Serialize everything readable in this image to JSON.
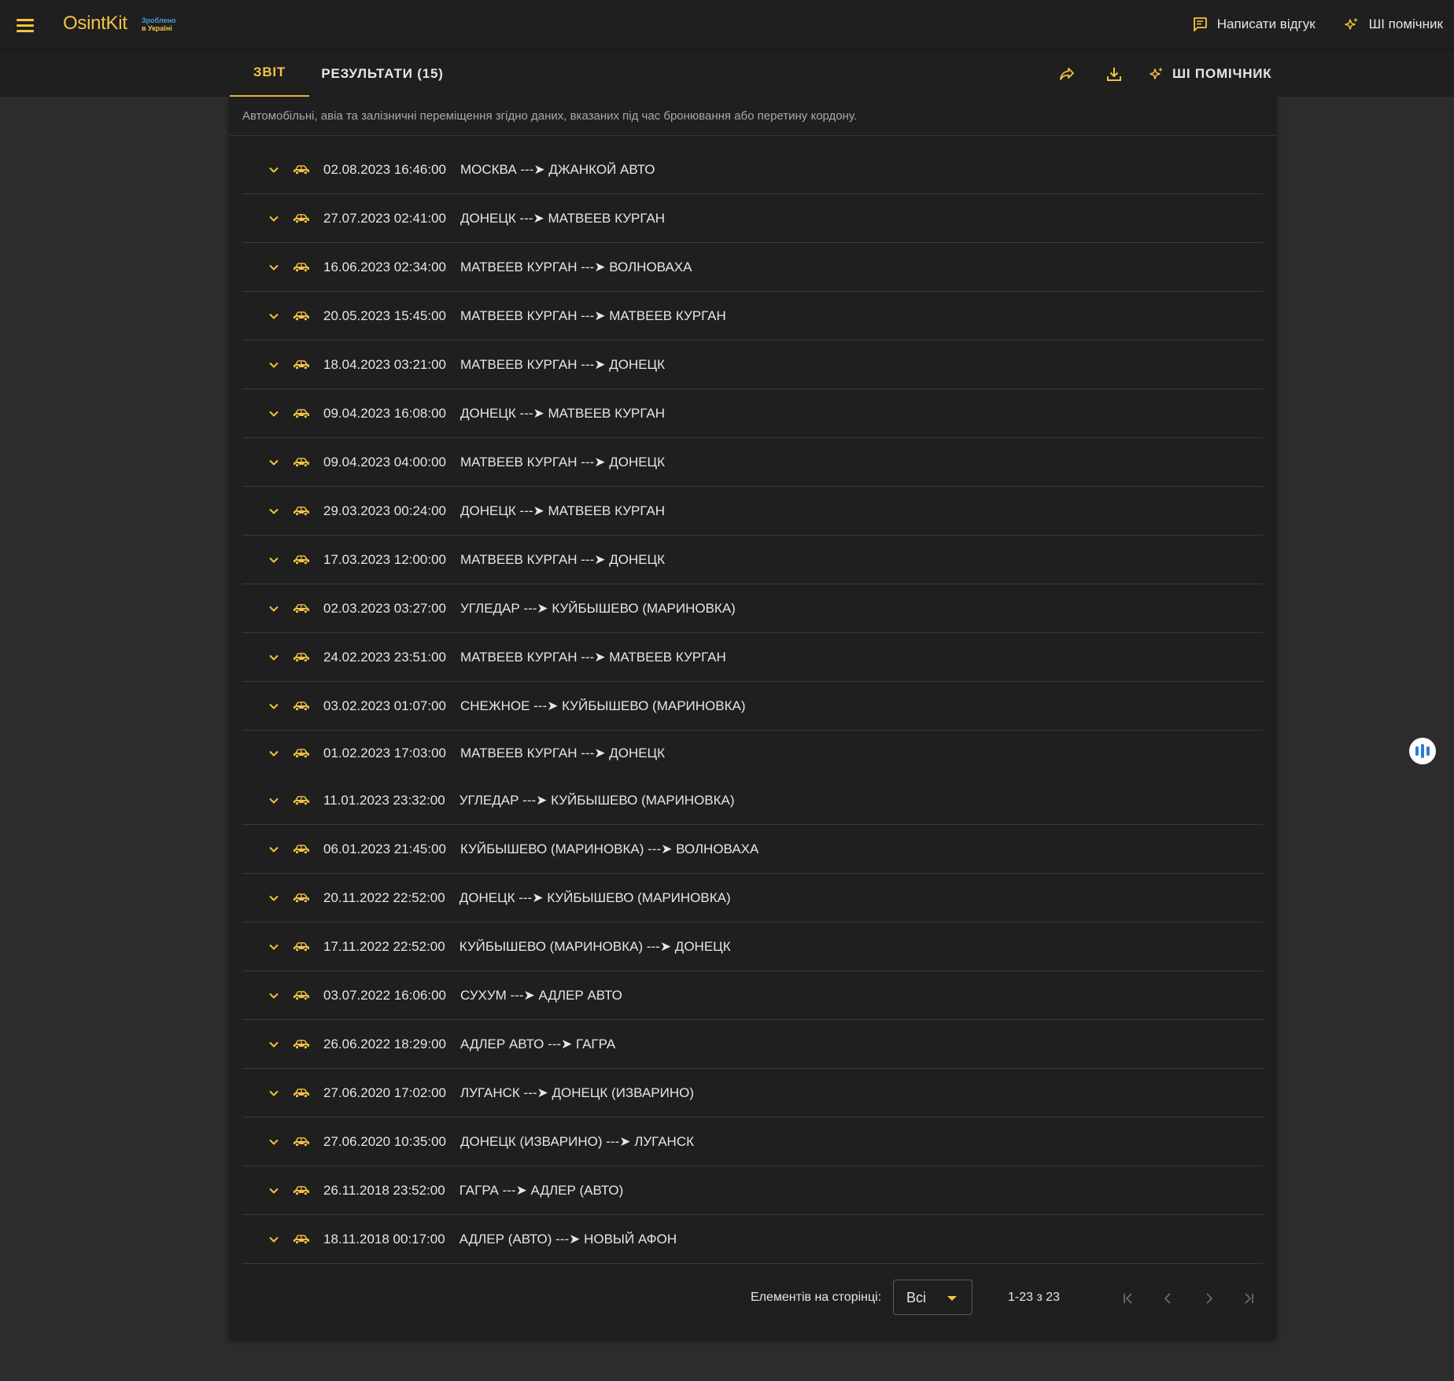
{
  "app": {
    "logo": "OsintKit",
    "badge_line1": "Зроблено",
    "badge_line2": "в Україні",
    "feedback_label": "Написати відгук",
    "ai_helper_label": "ШІ помічник"
  },
  "tabs": {
    "report": "ЗВІТ",
    "results": "РЕЗУЛЬТАТИ (15)",
    "ai_helper": "ШІ ПОМІЧНИК"
  },
  "description": "Автомобільні, авіа та залізничні переміщення згідно даних, вказаних під час бронювання або перетину кордону.",
  "trips": [
    {
      "time": "02.08.2023 16:46:00",
      "route": "МОСКВА ---➤ ДЖАНКОЙ АВТО",
      "icon": "car-icon"
    },
    {
      "time": "27.07.2023 02:41:00",
      "route": "ДОНЕЦК ---➤ МАТВЕЕВ КУРГАН",
      "icon": "car-icon"
    },
    {
      "time": "16.06.2023 02:34:00",
      "route": "МАТВЕЕВ КУРГАН ---➤ ВОЛНОВАХА",
      "icon": "car-icon"
    },
    {
      "time": "20.05.2023 15:45:00",
      "route": "МАТВЕЕВ КУРГАН ---➤ МАТВЕЕВ КУРГАН",
      "icon": "car-icon"
    },
    {
      "time": "18.04.2023 03:21:00",
      "route": "МАТВЕЕВ КУРГАН ---➤ ДОНЕЦК",
      "icon": "car-icon"
    },
    {
      "time": "09.04.2023 16:08:00",
      "route": "ДОНЕЦК ---➤ МАТВЕЕВ КУРГАН",
      "icon": "car-icon"
    },
    {
      "time": "09.04.2023 04:00:00",
      "route": "МАТВЕЕВ КУРГАН ---➤ ДОНЕЦК",
      "icon": "car-icon"
    },
    {
      "time": "29.03.2023 00:24:00",
      "route": "ДОНЕЦК ---➤ МАТВЕЕВ КУРГАН",
      "icon": "car-icon"
    },
    {
      "time": "17.03.2023 12:00:00",
      "route": "МАТВЕЕВ КУРГАН ---➤ ДОНЕЦК",
      "icon": "car-icon"
    },
    {
      "time": "02.03.2023 03:27:00",
      "route": "УГЛЕДАР ---➤ КУЙБЫШЕВО (МАРИНОВКА)",
      "icon": "car-icon"
    },
    {
      "time": "24.02.2023 23:51:00",
      "route": "МАТВЕЕВ КУРГАН ---➤ МАТВЕЕВ КУРГАН",
      "icon": "car-icon"
    },
    {
      "time": "03.02.2023 01:07:00",
      "route": "СНЕЖНОЕ ---➤ КУЙБЫШЕВО (МАРИНОВКА)",
      "icon": "car-icon"
    },
    {
      "time": "01.02.2023 17:03:00",
      "route": "МАТВЕЕВ КУРГАН ---➤ ДОНЕЦК",
      "icon": "car-icon"
    },
    {
      "time": "11.01.2023 23:32:00",
      "route": "УГЛЕДАР ---➤ КУЙБЫШЕВО (МАРИНОВКА)",
      "icon": "car-icon"
    },
    {
      "time": "06.01.2023 21:45:00",
      "route": "КУЙБЫШЕВО (МАРИНОВКА) ---➤ ВОЛНОВАХА",
      "icon": "car-icon"
    },
    {
      "time": "20.11.2022 22:52:00",
      "route": "ДОНЕЦК ---➤ КУЙБЫШЕВО (МАРИНОВКА)",
      "icon": "car-icon"
    },
    {
      "time": "17.11.2022 22:52:00",
      "route": "КУЙБЫШЕВО (МАРИНОВКА) ---➤ ДОНЕЦК",
      "icon": "car-icon"
    },
    {
      "time": "03.07.2022 16:06:00",
      "route": "СУХУМ ---➤ АДЛЕР АВТО",
      "icon": "car-icon"
    },
    {
      "time": "26.06.2022 18:29:00",
      "route": "АДЛЕР АВТО ---➤ ГАГРА",
      "icon": "car-icon"
    },
    {
      "time": "27.06.2020 17:02:00",
      "route": "ЛУГАНСК ---➤ ДОНЕЦК (ИЗВАРИНО)",
      "icon": "car-icon"
    },
    {
      "time": "27.06.2020 10:35:00",
      "route": "ДОНЕЦК (ИЗВАРИНО) ---➤ ЛУГАНСК",
      "icon": "car-icon"
    },
    {
      "time": "26.11.2018 23:52:00",
      "route": "ГАГРА ---➤ АДЛЕР (АВТО)",
      "icon": "car-icon"
    },
    {
      "time": "18.11.2018 00:17:00",
      "route": "АДЛЕР (АВТО) ---➤ НОВЫЙ АФОН",
      "icon": "car-icon"
    }
  ],
  "paginator": {
    "items_label": "Елементів на сторінці:",
    "page_size": "Всі",
    "range": "1-23 з 23"
  },
  "colors": {
    "accent": "#f5c242",
    "surface": "#1f1f1f",
    "background": "#2c2c2c",
    "fab_blue": "#2b7bd6"
  }
}
